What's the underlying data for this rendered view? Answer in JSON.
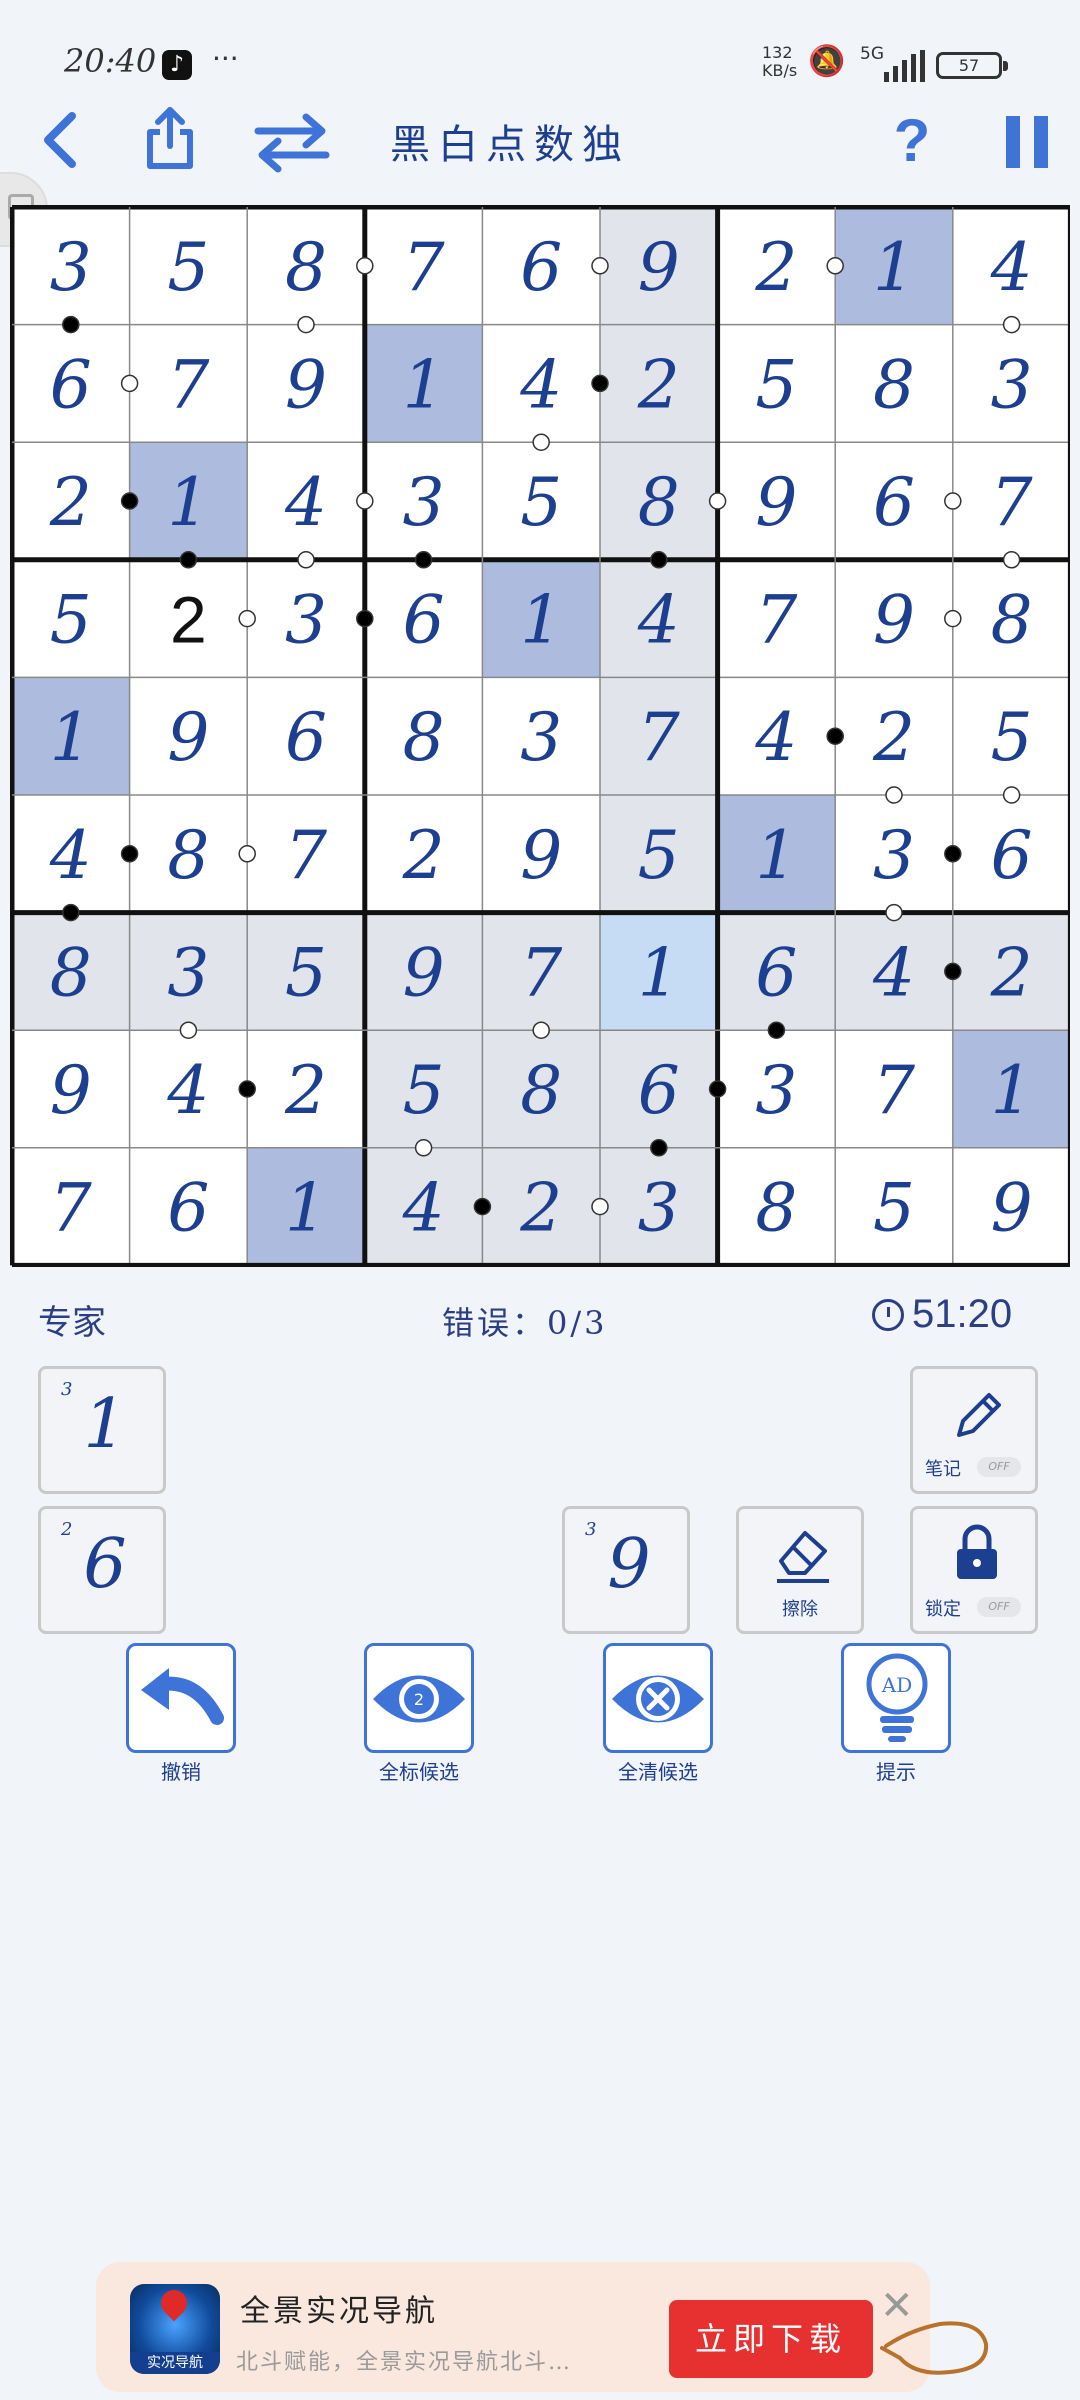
{
  "status_bar": {
    "time": "20:40",
    "app_icon": "tiktok-icon",
    "more": "···",
    "net_speed_top": "132",
    "net_speed_bottom": "KB/s",
    "network": "5G",
    "battery": "57"
  },
  "header": {
    "title": "黑白点数独",
    "back_icon": "back-chevron-icon",
    "share_icon": "share-icon",
    "switch_icon": "swap-arrows-icon",
    "help": "?",
    "pause_icon": "pause-icon"
  },
  "board": {
    "rows": [
      [
        3,
        5,
        8,
        7,
        6,
        9,
        2,
        1,
        4
      ],
      [
        6,
        7,
        9,
        1,
        4,
        2,
        5,
        8,
        3
      ],
      [
        2,
        1,
        4,
        3,
        5,
        8,
        9,
        6,
        7
      ],
      [
        5,
        2,
        3,
        6,
        1,
        4,
        7,
        9,
        8
      ],
      [
        1,
        9,
        6,
        8,
        3,
        7,
        4,
        2,
        5
      ],
      [
        4,
        8,
        7,
        2,
        9,
        5,
        1,
        3,
        6
      ],
      [
        8,
        3,
        5,
        9,
        7,
        1,
        6,
        4,
        2
      ],
      [
        9,
        4,
        2,
        5,
        8,
        6,
        3,
        7,
        1
      ],
      [
        7,
        6,
        1,
        4,
        2,
        3,
        8,
        5,
        9
      ]
    ],
    "given_black_cells": [
      [
        3,
        1
      ]
    ],
    "highlight_dark_cells": [
      [
        0,
        7
      ],
      [
        1,
        3
      ],
      [
        2,
        1
      ],
      [
        3,
        4
      ],
      [
        4,
        0
      ],
      [
        5,
        6
      ],
      [
        7,
        8
      ],
      [
        8,
        2
      ]
    ],
    "selected_cell": [
      6,
      5
    ],
    "shaded_row": 6,
    "shaded_col": 5,
    "shaded_box": [
      2,
      1
    ],
    "h_dots": [
      {
        "r": 0,
        "c": 2,
        "color": "white"
      },
      {
        "r": 0,
        "c": 4,
        "color": "white"
      },
      {
        "r": 0,
        "c": 6,
        "color": "white"
      },
      {
        "r": 1,
        "c": 0,
        "color": "white"
      },
      {
        "r": 1,
        "c": 4,
        "color": "black"
      },
      {
        "r": 2,
        "c": 0,
        "color": "black"
      },
      {
        "r": 2,
        "c": 2,
        "color": "white"
      },
      {
        "r": 2,
        "c": 5,
        "color": "white"
      },
      {
        "r": 2,
        "c": 7,
        "color": "white"
      },
      {
        "r": 3,
        "c": 1,
        "color": "white"
      },
      {
        "r": 3,
        "c": 2,
        "color": "black"
      },
      {
        "r": 3,
        "c": 7,
        "color": "white"
      },
      {
        "r": 4,
        "c": 6,
        "color": "black"
      },
      {
        "r": 5,
        "c": 0,
        "color": "black"
      },
      {
        "r": 5,
        "c": 1,
        "color": "white"
      },
      {
        "r": 5,
        "c": 7,
        "color": "black"
      },
      {
        "r": 6,
        "c": 7,
        "color": "black"
      },
      {
        "r": 7,
        "c": 1,
        "color": "black"
      },
      {
        "r": 7,
        "c": 5,
        "color": "black"
      },
      {
        "r": 8,
        "c": 3,
        "color": "black"
      },
      {
        "r": 8,
        "c": 4,
        "color": "white"
      }
    ],
    "v_dots": [
      {
        "r": 0,
        "c": 0,
        "color": "black"
      },
      {
        "r": 0,
        "c": 2,
        "color": "white"
      },
      {
        "r": 0,
        "c": 8,
        "color": "white"
      },
      {
        "r": 1,
        "c": 4,
        "color": "white"
      },
      {
        "r": 2,
        "c": 1,
        "color": "black"
      },
      {
        "r": 2,
        "c": 2,
        "color": "white"
      },
      {
        "r": 2,
        "c": 3,
        "color": "black"
      },
      {
        "r": 2,
        "c": 5,
        "color": "black"
      },
      {
        "r": 2,
        "c": 8,
        "color": "white"
      },
      {
        "r": 4,
        "c": 7,
        "color": "white"
      },
      {
        "r": 4,
        "c": 8,
        "color": "white"
      },
      {
        "r": 5,
        "c": 0,
        "color": "black"
      },
      {
        "r": 5,
        "c": 7,
        "color": "white"
      },
      {
        "r": 6,
        "c": 1,
        "color": "white"
      },
      {
        "r": 6,
        "c": 4,
        "color": "white"
      },
      {
        "r": 6,
        "c": 6,
        "color": "black"
      },
      {
        "r": 7,
        "c": 3,
        "color": "white"
      },
      {
        "r": 7,
        "c": 5,
        "color": "black"
      }
    ]
  },
  "info": {
    "difficulty": "专家",
    "errors": "错误：0/3",
    "timer": "51:20"
  },
  "remaining": [
    {
      "value": "1",
      "count": "3"
    },
    {
      "value": "6",
      "count": "2"
    },
    {
      "value": "9",
      "count": "3"
    }
  ],
  "tools": {
    "notes_label": "笔记",
    "notes_toggle": "OFF",
    "erase_label": "擦除",
    "lock_label": "锁定",
    "lock_toggle": "OFF",
    "notes_icon": "pencil-icon",
    "erase_icon": "eraser-icon",
    "lock_icon": "lock-icon"
  },
  "actions": [
    {
      "label": "撤销",
      "icon": "undo-icon"
    },
    {
      "label": "全标候选",
      "icon": "eye-candidates-icon",
      "badge": "2"
    },
    {
      "label": "全清候选",
      "icon": "clear-candidates-icon"
    },
    {
      "label": "提示",
      "icon": "hint-bulb-icon",
      "badge": "AD"
    }
  ],
  "ad": {
    "title": "全景实况导航",
    "subtitle": "北斗赋能，全景实况导航北斗…",
    "logo_caption": "实况导航",
    "button": "立即下载",
    "close": "✕"
  }
}
